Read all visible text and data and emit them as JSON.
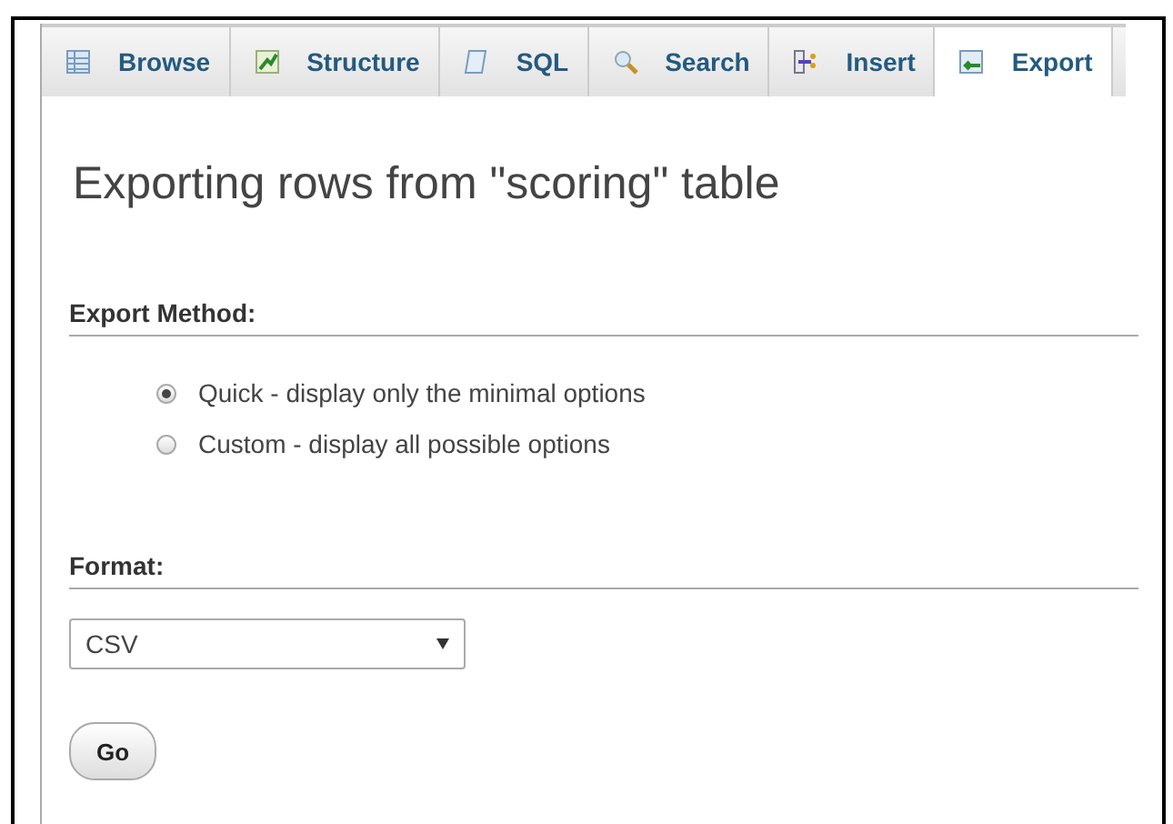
{
  "tabs": [
    {
      "label": "Browse",
      "selected": false
    },
    {
      "label": "Structure",
      "selected": false
    },
    {
      "label": "SQL",
      "selected": false
    },
    {
      "label": "Search",
      "selected": false
    },
    {
      "label": "Insert",
      "selected": false
    },
    {
      "label": "Export",
      "selected": true
    }
  ],
  "title": "Exporting rows from \"scoring\" table",
  "export_method": {
    "heading": "Export Method:",
    "options": [
      {
        "label": "Quick - display only the minimal options",
        "selected": true
      },
      {
        "label": "Custom - display all possible options",
        "selected": false
      }
    ]
  },
  "format": {
    "heading": "Format:",
    "value": "CSV"
  },
  "buttons": [
    "Go"
  ]
}
